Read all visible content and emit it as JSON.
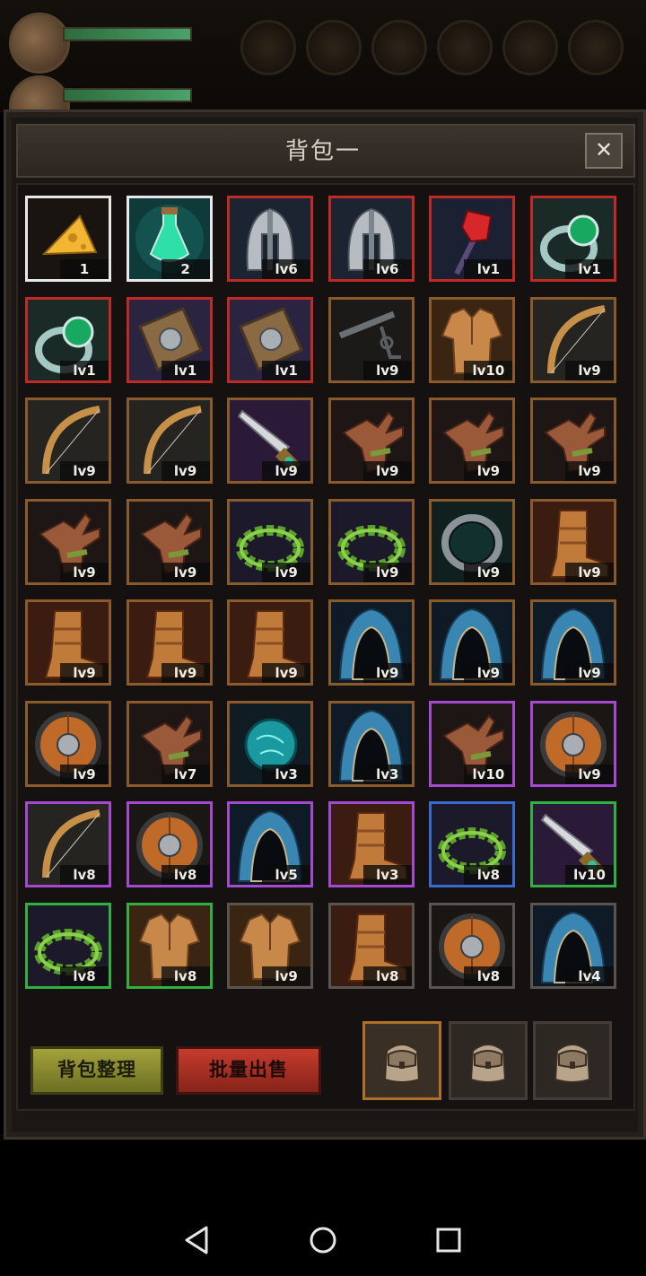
{
  "colors": {
    "rarity_white": "#e8e8e8",
    "rarity_red": "#c02a25",
    "rarity_orange": "#8a5a2a",
    "rarity_purple": "#a54ad0",
    "rarity_blue": "#3a6ad0",
    "rarity_green": "#2fb040",
    "accent_active_tab": "#b0702a"
  },
  "top_bar": {
    "avatars": [
      "player-avatar-icon",
      "companion-avatar-icon"
    ],
    "skills": [
      "horn-skill-icon",
      "coffin-skill-icon",
      "potion-skill-icon",
      "leaf-skill-icon",
      "net-skill-icon",
      "orb-skill-icon"
    ]
  },
  "panel": {
    "title": "背包一",
    "close_label": "✕",
    "items": [
      {
        "icon": "cheese-icon",
        "label": "1",
        "rarity": "white"
      },
      {
        "icon": "potion-icon",
        "label": "2",
        "rarity": "white"
      },
      {
        "icon": "helmet-icon",
        "label": "lv6",
        "rarity": "red"
      },
      {
        "icon": "helmet-icon",
        "label": "lv6",
        "rarity": "red"
      },
      {
        "icon": "ruby-staff-icon",
        "label": "lv1",
        "rarity": "red"
      },
      {
        "icon": "emerald-ring-icon",
        "label": "lv1",
        "rarity": "red"
      },
      {
        "icon": "emerald-ring-icon",
        "label": "lv1",
        "rarity": "red"
      },
      {
        "icon": "wooden-shield-icon",
        "label": "lv1",
        "rarity": "red"
      },
      {
        "icon": "wooden-shield-icon",
        "label": "lv1",
        "rarity": "red"
      },
      {
        "icon": "crossbow-icon",
        "label": "lv9",
        "rarity": "orange"
      },
      {
        "icon": "leather-shirt-icon",
        "label": "lv10",
        "rarity": "orange"
      },
      {
        "icon": "bow-icon",
        "label": "lv9",
        "rarity": "orange"
      },
      {
        "icon": "bow-icon",
        "label": "lv9",
        "rarity": "orange"
      },
      {
        "icon": "bow-icon",
        "label": "lv9",
        "rarity": "orange"
      },
      {
        "icon": "dagger-icon",
        "label": "lv9",
        "rarity": "orange"
      },
      {
        "icon": "glove-icon",
        "label": "lv9",
        "rarity": "orange"
      },
      {
        "icon": "glove-icon",
        "label": "lv9",
        "rarity": "orange"
      },
      {
        "icon": "glove-icon",
        "label": "lv9",
        "rarity": "orange"
      },
      {
        "icon": "glove-icon",
        "label": "lv9",
        "rarity": "orange"
      },
      {
        "icon": "glove-icon",
        "label": "lv9",
        "rarity": "orange"
      },
      {
        "icon": "laurel-wreath-icon",
        "label": "lv9",
        "rarity": "orange"
      },
      {
        "icon": "laurel-wreath-icon",
        "label": "lv9",
        "rarity": "orange"
      },
      {
        "icon": "iron-ring-icon",
        "label": "lv9",
        "rarity": "orange"
      },
      {
        "icon": "boot-icon",
        "label": "lv9",
        "rarity": "orange"
      },
      {
        "icon": "boot-icon",
        "label": "lv9",
        "rarity": "orange"
      },
      {
        "icon": "boot-icon",
        "label": "lv9",
        "rarity": "orange"
      },
      {
        "icon": "boot-icon",
        "label": "lv9",
        "rarity": "orange"
      },
      {
        "icon": "hood-icon",
        "label": "lv9",
        "rarity": "orange"
      },
      {
        "icon": "hood-icon",
        "label": "lv9",
        "rarity": "orange"
      },
      {
        "icon": "hood-icon",
        "label": "lv9",
        "rarity": "orange"
      },
      {
        "icon": "round-shield-icon",
        "label": "lv9",
        "rarity": "orange"
      },
      {
        "icon": "glove-icon",
        "label": "lv7",
        "rarity": "orange"
      },
      {
        "icon": "crystal-orb-icon",
        "label": "lv3",
        "rarity": "orange"
      },
      {
        "icon": "hood-icon",
        "label": "lv3",
        "rarity": "orange"
      },
      {
        "icon": "glove-icon",
        "label": "lv10",
        "rarity": "purple"
      },
      {
        "icon": "round-shield-icon",
        "label": "lv9",
        "rarity": "purple"
      },
      {
        "icon": "bow-icon",
        "label": "lv8",
        "rarity": "purple"
      },
      {
        "icon": "round-shield-icon",
        "label": "lv8",
        "rarity": "purple"
      },
      {
        "icon": "hood-icon",
        "label": "lv5",
        "rarity": "purple"
      },
      {
        "icon": "boot-icon",
        "label": "lv3",
        "rarity": "purple"
      },
      {
        "icon": "laurel-wreath-icon",
        "label": "lv8",
        "rarity": "blue"
      },
      {
        "icon": "dagger-icon",
        "label": "lv10",
        "rarity": "green"
      },
      {
        "icon": "laurel-wreath-icon",
        "label": "lv8",
        "rarity": "green"
      },
      {
        "icon": "leather-shirt-icon",
        "label": "lv8",
        "rarity": "green"
      },
      {
        "icon": "leather-shirt-icon",
        "label": "lv9",
        "rarity": "gray"
      },
      {
        "icon": "boot-icon",
        "label": "lv8",
        "rarity": "gray"
      },
      {
        "icon": "round-shield-icon",
        "label": "lv8",
        "rarity": "gray"
      },
      {
        "icon": "hood-icon",
        "label": "lv4",
        "rarity": "gray"
      }
    ]
  },
  "buttons": {
    "sort_label": "背包整理",
    "sell_label": "批量出售"
  },
  "bag_tabs": [
    {
      "icon": "backpack-icon",
      "active": true
    },
    {
      "icon": "backpack-icon",
      "active": false
    },
    {
      "icon": "backpack-icon",
      "active": false
    }
  ],
  "system_nav": [
    "back-icon",
    "home-icon",
    "recents-icon"
  ]
}
